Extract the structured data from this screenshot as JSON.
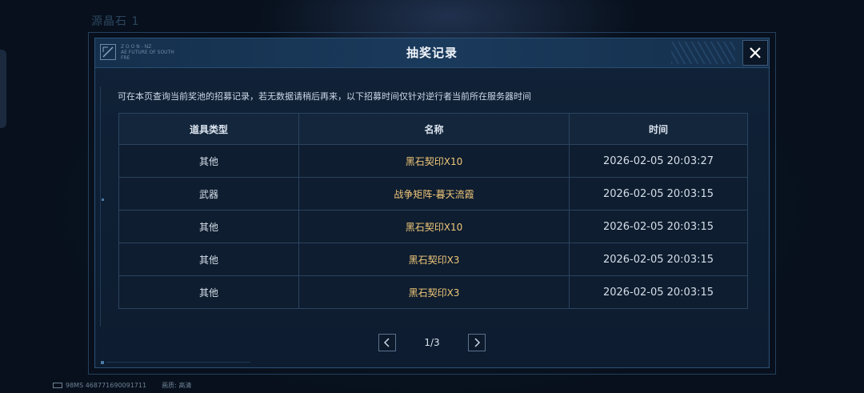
{
  "background": {
    "title": "源晶石 1"
  },
  "modal": {
    "title": "抽奖记录",
    "hint": "可在本页查询当前奖池的招募记录，若无数据请稍后再来，以下招募时间仅针对逆行者当前所在服务器时间",
    "header_code_line1": "Z O O N - NZ",
    "header_code_line2": "AE FUTURE OF SOUTH FRE"
  },
  "table": {
    "headers": [
      "道具类型",
      "名称",
      "时间"
    ],
    "rows": [
      {
        "type": "其他",
        "name": "黑石契印X10",
        "time": "2026-02-05 20:03:27"
      },
      {
        "type": "武器",
        "name": "战争矩阵-暮天流霞",
        "time": "2026-02-05 20:03:15"
      },
      {
        "type": "其他",
        "name": "黑石契印X10",
        "time": "2026-02-05 20:03:15"
      },
      {
        "type": "其他",
        "name": "黑石契印X3",
        "time": "2026-02-05 20:03:15"
      },
      {
        "type": "其他",
        "name": "黑石契印X3",
        "time": "2026-02-05 20:03:15"
      }
    ]
  },
  "pager": {
    "label": "1/3"
  },
  "footer": {
    "ping": "98MS",
    "uid": "468771690091711",
    "quality_label": "画质:",
    "quality_value": "高清"
  },
  "colors": {
    "accent_item": "#f0c77a",
    "border": "#2a4460"
  }
}
